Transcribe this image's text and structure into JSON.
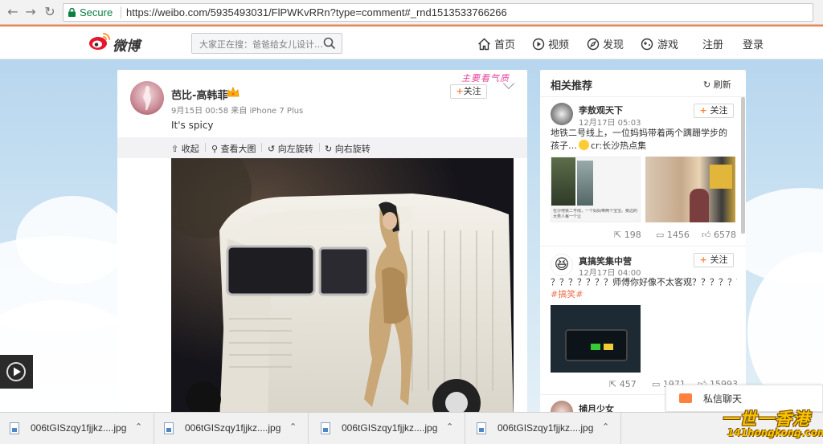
{
  "browser": {
    "back_icon": "arrow-left-icon",
    "forward_icon": "arrow-right-icon",
    "reload_icon": "reload-icon",
    "secure_label": "Secure",
    "url": "https://weibo.com/5935493031/FlPWKvRRn?type=comment#_rnd1513533766266"
  },
  "header": {
    "logo_text": "微博",
    "search_placeholder": "大家正在搜：爸爸给女儿设计…",
    "nav": [
      {
        "label": "首页",
        "icon": "home-icon"
      },
      {
        "label": "视频",
        "icon": "video-icon"
      },
      {
        "label": "发现",
        "icon": "discover-icon"
      },
      {
        "label": "游戏",
        "icon": "game-icon"
      }
    ],
    "register": "注册",
    "login": "登录"
  },
  "post": {
    "username": "芭比-高韩菲",
    "meta": "9月15日 00:58 来自 iPhone 7 Plus",
    "text": "It's spicy",
    "follow_plus": "+",
    "follow_label": "关注",
    "sticker": "主要看气质",
    "tools": [
      "收起",
      "查看大图",
      "向左旋转",
      "向右旋转"
    ]
  },
  "sidebar": {
    "title": "相关推荐",
    "refresh": "刷新",
    "items": [
      {
        "name": "李敖观天下",
        "time": "12月17日 05:03",
        "follow": "关注",
        "text": "地铁二号线上，一位妈妈带着两个蹒跚学步的孩子…",
        "tag": "cr:长沙热点集",
        "thumb_caption": "在沙地铁二号线，一个妈妈带两个宝宝。旁边的大男人每一个让",
        "reposts": "198",
        "comments": "1456",
        "likes": "6578"
      },
      {
        "name": "真搞笑集中营",
        "time": "12月17日 04:00",
        "follow": "关注",
        "text": "？？？？？？？师傅你好像不太客观？？？？？？",
        "tag": "#搞笑#",
        "reposts": "457",
        "comments": "1971",
        "likes": "15993"
      },
      {
        "name": "捕月少女"
      }
    ]
  },
  "message": {
    "label": "私信聊天"
  },
  "downloads": [
    {
      "name": "006tGISzqy1fjjkz....jpg"
    },
    {
      "name": "006tGISzqy1fjjkz....jpg"
    },
    {
      "name": "006tGISzqy1fjjkz....jpg"
    },
    {
      "name": "006tGISzqy1fjjkz....jpg"
    }
  ],
  "watermark": {
    "line1": "一世一香港",
    "line2": "141hongkong.com"
  },
  "colors": {
    "weibo_orange": "#ff8140",
    "secure_green": "#0b8043",
    "topic_link": "#eb7350"
  }
}
